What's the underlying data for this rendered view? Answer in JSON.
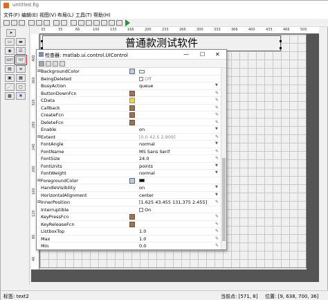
{
  "window": {
    "title": "untitled.fig"
  },
  "menu": [
    "文件(F)",
    "编辑(E)",
    "视图(V)",
    "布局(L)",
    "工具(T)",
    "帮助(H)"
  ],
  "ruler_top": [
    "33",
    "33",
    "66",
    "100",
    "133",
    "166",
    "200",
    "233",
    "266",
    "300",
    "333",
    "366",
    "400",
    "433",
    "466",
    "500"
  ],
  "ruler_left": [
    "400",
    "360",
    "320",
    "280",
    "240",
    "200",
    "160",
    "120",
    "80",
    "40"
  ],
  "canvas": {
    "button_text": "普通款测试软件"
  },
  "palette": [
    {
      "name": "select-icon",
      "glyph": "➤"
    },
    {
      "name": "pushbutton-icon",
      "glyph": "▭"
    },
    {
      "name": "slider-icon",
      "glyph": "▬"
    },
    {
      "name": "radio-icon",
      "glyph": "◉"
    },
    {
      "name": "checkbox-icon",
      "glyph": "☑"
    },
    {
      "name": "edit-text-icon",
      "glyph": "EDIT"
    },
    {
      "name": "static-text-icon",
      "glyph": "TXT"
    },
    {
      "name": "popup-icon",
      "glyph": "▤"
    },
    {
      "name": "listbox-icon",
      "glyph": "≡"
    },
    {
      "name": "toggle-icon",
      "glyph": "▣"
    },
    {
      "name": "table-icon",
      "glyph": "▦"
    },
    {
      "name": "axes-icon",
      "glyph": "📈"
    },
    {
      "name": "panel-icon",
      "glyph": "▢"
    },
    {
      "name": "buttongroup-icon",
      "glyph": "▩"
    },
    {
      "name": "activex-icon",
      "glyph": "✖"
    }
  ],
  "inspector": {
    "title": "检查器:  matlab.ui.control.UIControl",
    "rows": [
      {
        "exp": "⊞",
        "name": "BackgroundColor",
        "edit": "paint",
        "value": "",
        "kind": "color"
      },
      {
        "exp": "",
        "name": "BeingDeleted",
        "edit": "",
        "value": "Off",
        "kind": "checkbox-gray"
      },
      {
        "exp": "",
        "name": "BusyAction",
        "edit": "",
        "value": "queue",
        "kind": "dd"
      },
      {
        "exp": "",
        "name": "ButtonDownFcn",
        "edit": "edit",
        "value": "",
        "kind": "pen"
      },
      {
        "exp": "",
        "name": "CData",
        "edit": "cdata",
        "value": "",
        "kind": "pen"
      },
      {
        "exp": "",
        "name": "Callback",
        "edit": "edit",
        "value": "",
        "kind": "pen"
      },
      {
        "exp": "",
        "name": "CreateFcn",
        "edit": "edit",
        "value": "",
        "kind": "pen"
      },
      {
        "exp": "",
        "name": "DeleteFcn",
        "edit": "edit",
        "value": "",
        "kind": "pen"
      },
      {
        "exp": "",
        "name": "Enable",
        "edit": "",
        "value": "on",
        "kind": "dd"
      },
      {
        "exp": "⊞",
        "name": "Extent",
        "edit": "",
        "value": "[0.0 42.5 2.909]",
        "kind": "gray"
      },
      {
        "exp": "",
        "name": "FontAngle",
        "edit": "",
        "value": "normal",
        "kind": "dd"
      },
      {
        "exp": "",
        "name": "FontName",
        "edit": "",
        "value": "MS Sans Serif",
        "kind": "pen"
      },
      {
        "exp": "",
        "name": "FontSize",
        "edit": "",
        "value": "24.0",
        "kind": "pen"
      },
      {
        "exp": "",
        "name": "FontUnits",
        "edit": "",
        "value": "points",
        "kind": "dd"
      },
      {
        "exp": "",
        "name": "FontWeight",
        "edit": "",
        "value": "normal",
        "kind": "dd"
      },
      {
        "exp": "⊞",
        "name": "ForegroundColor",
        "edit": "paint",
        "value": "",
        "kind": "color-black"
      },
      {
        "exp": "",
        "name": "HandleVisibility",
        "edit": "",
        "value": "on",
        "kind": "dd"
      },
      {
        "exp": "",
        "name": "HorizontalAlignment",
        "edit": "",
        "value": "center",
        "kind": "dd"
      },
      {
        "exp": "⊞",
        "name": "InnerPosition",
        "edit": "",
        "value": "[1.625 43.455 131.375 2.455]",
        "kind": "pen"
      },
      {
        "exp": "",
        "name": "Interruptible",
        "edit": "",
        "value": "On",
        "kind": "checkbox"
      },
      {
        "exp": "",
        "name": "KeyPressFcn",
        "edit": "edit",
        "value": "",
        "kind": "pen"
      },
      {
        "exp": "",
        "name": "KeyReleaseFcn",
        "edit": "edit",
        "value": "",
        "kind": "pen"
      },
      {
        "exp": "",
        "name": "ListboxTop",
        "edit": "",
        "value": "1.0",
        "kind": "pen"
      },
      {
        "exp": "",
        "name": "Max",
        "edit": "",
        "value": "1.0",
        "kind": "pen"
      },
      {
        "exp": "",
        "name": "Min",
        "edit": "",
        "value": "0.0",
        "kind": "pen"
      }
    ]
  },
  "status": {
    "tag": "标签: text2",
    "current_point": "当前点: [571, 8]",
    "position": "位置: [9, 638, 700, 36]"
  }
}
